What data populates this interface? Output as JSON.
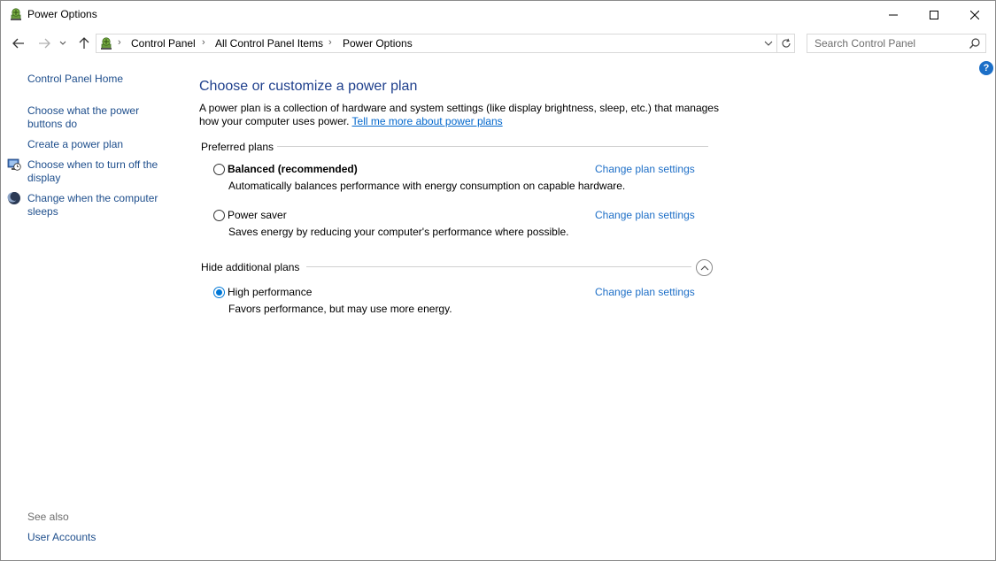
{
  "window": {
    "title": "Power Options",
    "controls": {
      "minimize": "minimize-icon",
      "maximize": "maximize-icon",
      "close": "close-icon"
    }
  },
  "navigation": {
    "back": "arrow-left-icon",
    "forward": "arrow-right-icon",
    "recent": "chevron-down-icon",
    "up": "arrow-up-icon"
  },
  "address": {
    "breadcrumbs": [
      "Control Panel",
      "All Control Panel Items",
      "Power Options"
    ],
    "separator": "›"
  },
  "search": {
    "placeholder": "Search Control Panel",
    "value": ""
  },
  "help": {
    "label": "?"
  },
  "sidebar": {
    "home": "Control Panel Home",
    "links": [
      {
        "label": "Choose what the power buttons do",
        "icon": ""
      },
      {
        "label": "Create a power plan",
        "icon": ""
      },
      {
        "label": "Choose when to turn off the display",
        "icon": "display-clock-icon"
      },
      {
        "label": "Change when the computer sleeps",
        "icon": "moon-icon"
      }
    ],
    "see_also_label": "See also",
    "see_also_links": [
      "User Accounts"
    ]
  },
  "main": {
    "title": "Choose or customize a power plan",
    "description": "A power plan is a collection of hardware and system settings (like display brightness, sleep, etc.) that manages how your computer uses power.",
    "description_link": "Tell me more about power plans",
    "preferred_header": "Preferred plans",
    "additional_header": "Hide additional plans",
    "change_link_label": "Change plan settings",
    "plans": [
      {
        "name": "Balanced (recommended)",
        "description": "Automatically balances performance with energy consumption on capable hardware.",
        "selected": false
      },
      {
        "name": "Power saver",
        "description": "Saves energy by reducing your computer's performance where possible.",
        "selected": false
      },
      {
        "name": "High performance",
        "description": "Favors performance, but may use more energy.",
        "selected": true
      }
    ]
  },
  "colors": {
    "link": "#1e6fc7",
    "title": "#1e3f8c",
    "radio_selected": "#0078d7",
    "help_badge": "#1c6fc7"
  }
}
